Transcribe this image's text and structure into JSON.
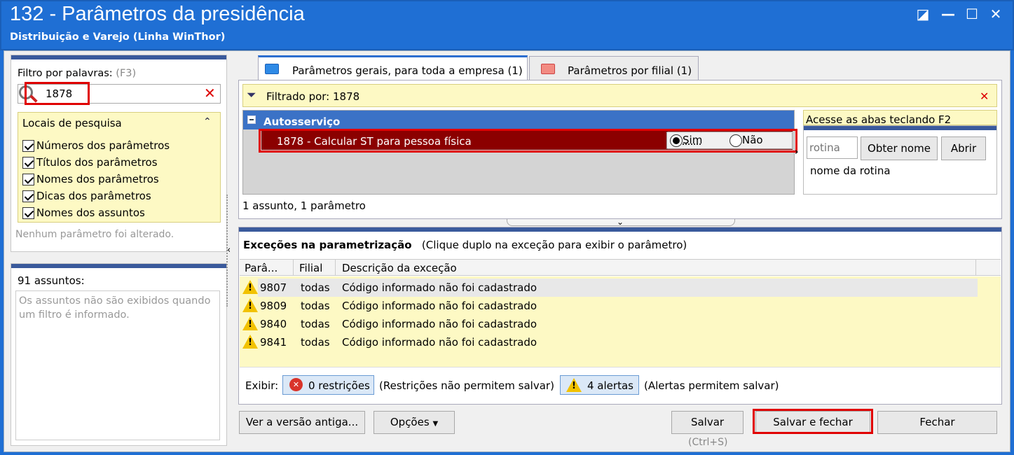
{
  "window": {
    "title": "132 - Parâmetros da presidência",
    "subtitle": "Distribuição e Varejo (Linha WinThor)"
  },
  "filter": {
    "label": "Filtro por palavras:",
    "hint": "(F3)",
    "value": "1878",
    "search_locations_label": "Locais de pesquisa",
    "locations": [
      {
        "label": "Números dos parâmetros",
        "checked": true
      },
      {
        "label": "Títulos dos parâmetros",
        "checked": true
      },
      {
        "label": "Nomes dos parâmetros",
        "checked": true
      },
      {
        "label": "Dicas dos parâmetros",
        "checked": true
      },
      {
        "label": "Nomes dos assuntos",
        "checked": true
      }
    ],
    "status": "Nenhum parâmetro foi alterado."
  },
  "subjects": {
    "count_label": "91 assuntos:",
    "note": "Os assuntos não são exibidos quando um filtro é informado."
  },
  "tabs": [
    {
      "label": "Parâmetros gerais, para toda a empresa",
      "count": "(1)",
      "active": true
    },
    {
      "label": "Parâmetros por filial",
      "count": "(1)",
      "active": false
    }
  ],
  "filtered_bar": {
    "text": "Filtrado por: 1878"
  },
  "group": {
    "name": "Autosserviço",
    "param_title": "1878 - Calcular ST para pessoa física",
    "option_yes": "Sim",
    "option_no": "Não",
    "selected": "Sim"
  },
  "side_panel": {
    "hint": "Acesse as abas teclando F2",
    "routine_placeholder": "rotina",
    "get_name_button": "Obter nome",
    "open_button": "Abrir",
    "routine_name": "nome da rotina"
  },
  "summary": "1 assunto, 1 parâmetro",
  "exceptions": {
    "title": "Exceções na parametrização",
    "hint": "(Clique duplo na exceção para exibir o parâmetro)",
    "columns": [
      "Parâ...",
      "Filial",
      "Descrição da exceção"
    ],
    "rows": [
      {
        "param": "9807",
        "filial": "todas",
        "desc": "Código informado não foi cadastrado"
      },
      {
        "param": "9809",
        "filial": "todas",
        "desc": "Código informado não foi cadastrado"
      },
      {
        "param": "9840",
        "filial": "todas",
        "desc": "Código informado não foi cadastrado"
      },
      {
        "param": "9841",
        "filial": "todas",
        "desc": "Código informado não foi cadastrado"
      }
    ],
    "show_label": "Exibir:",
    "restrictions_button": "0 restrições",
    "restrictions_note": "(Restrições não permitem salvar)",
    "alerts_button": "4 alertas",
    "alerts_note": "(Alertas permitem salvar)"
  },
  "footer": {
    "old_version_button": "Ver a versão antiga...",
    "options_button": "Opções",
    "save_button": "Salvar",
    "save_shortcut": "(Ctrl+S)",
    "save_close_button": "Salvar e fechar",
    "close_button": "Fechar"
  },
  "colors": {
    "titlebar": "#1f6fd4",
    "selected_row": "#8b0000",
    "highlight_box": "#e00000",
    "yellow_panel": "#fdf9c4"
  }
}
